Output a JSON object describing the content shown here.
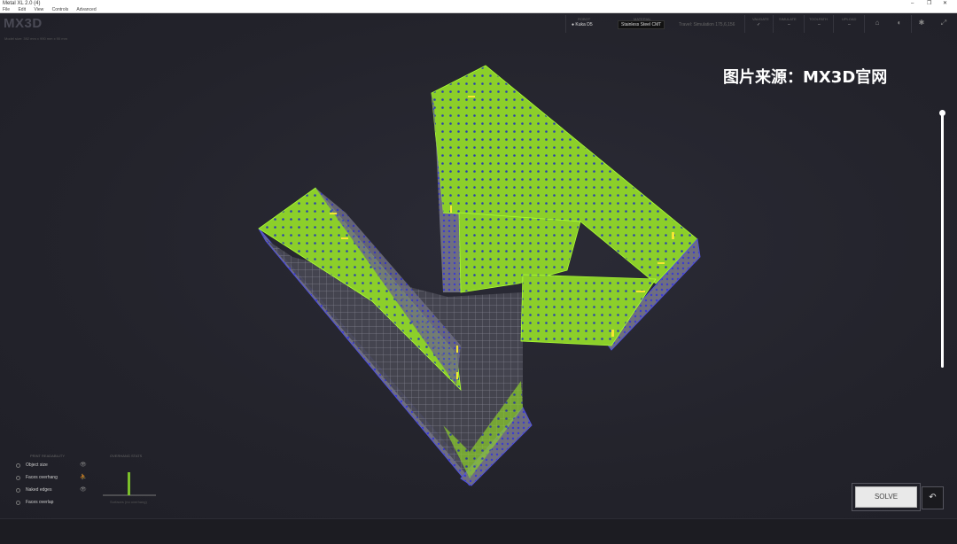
{
  "window": {
    "title": "Metal XL 2.0 (4)",
    "controls": [
      "–",
      "❐",
      "✕"
    ]
  },
  "menu": [
    "File",
    "Edit",
    "View",
    "Controls",
    "Advanced"
  ],
  "app": {
    "logo": "MX3D",
    "subtext": "Model size: 392 mm x 990 mm x 90 mm"
  },
  "header": {
    "robot_label": "ROBOT",
    "robot_value": "Kuka D5",
    "material_label": "MATERIAL",
    "material_value": "Stainless Steel CMT",
    "status_text": "Travel: Simulation  175,6,156",
    "cols": [
      {
        "label": "VALIDATE",
        "value": "✓"
      },
      {
        "label": "SIMULATE",
        "value": "–"
      },
      {
        "label": "TOOLPATH",
        "value": "–"
      },
      {
        "label": "UPLOAD",
        "value": "–"
      }
    ]
  },
  "watermark": "图片来源：MX3D官网",
  "printability": {
    "title": "PRINT READABILITY",
    "items": [
      {
        "label": "Object size",
        "icon": "eye-icon"
      },
      {
        "label": "Faces overhang",
        "icon": "person-icon"
      },
      {
        "label": "Naked edges",
        "icon": "eye-icon"
      },
      {
        "label": "Faces overlap",
        "icon": ""
      }
    ]
  },
  "overhang": {
    "title": "OVERHANG STATS",
    "caption": "Surfaces (no overhang)"
  },
  "buttons": {
    "solve": "SOLVE",
    "undo": "↶"
  }
}
